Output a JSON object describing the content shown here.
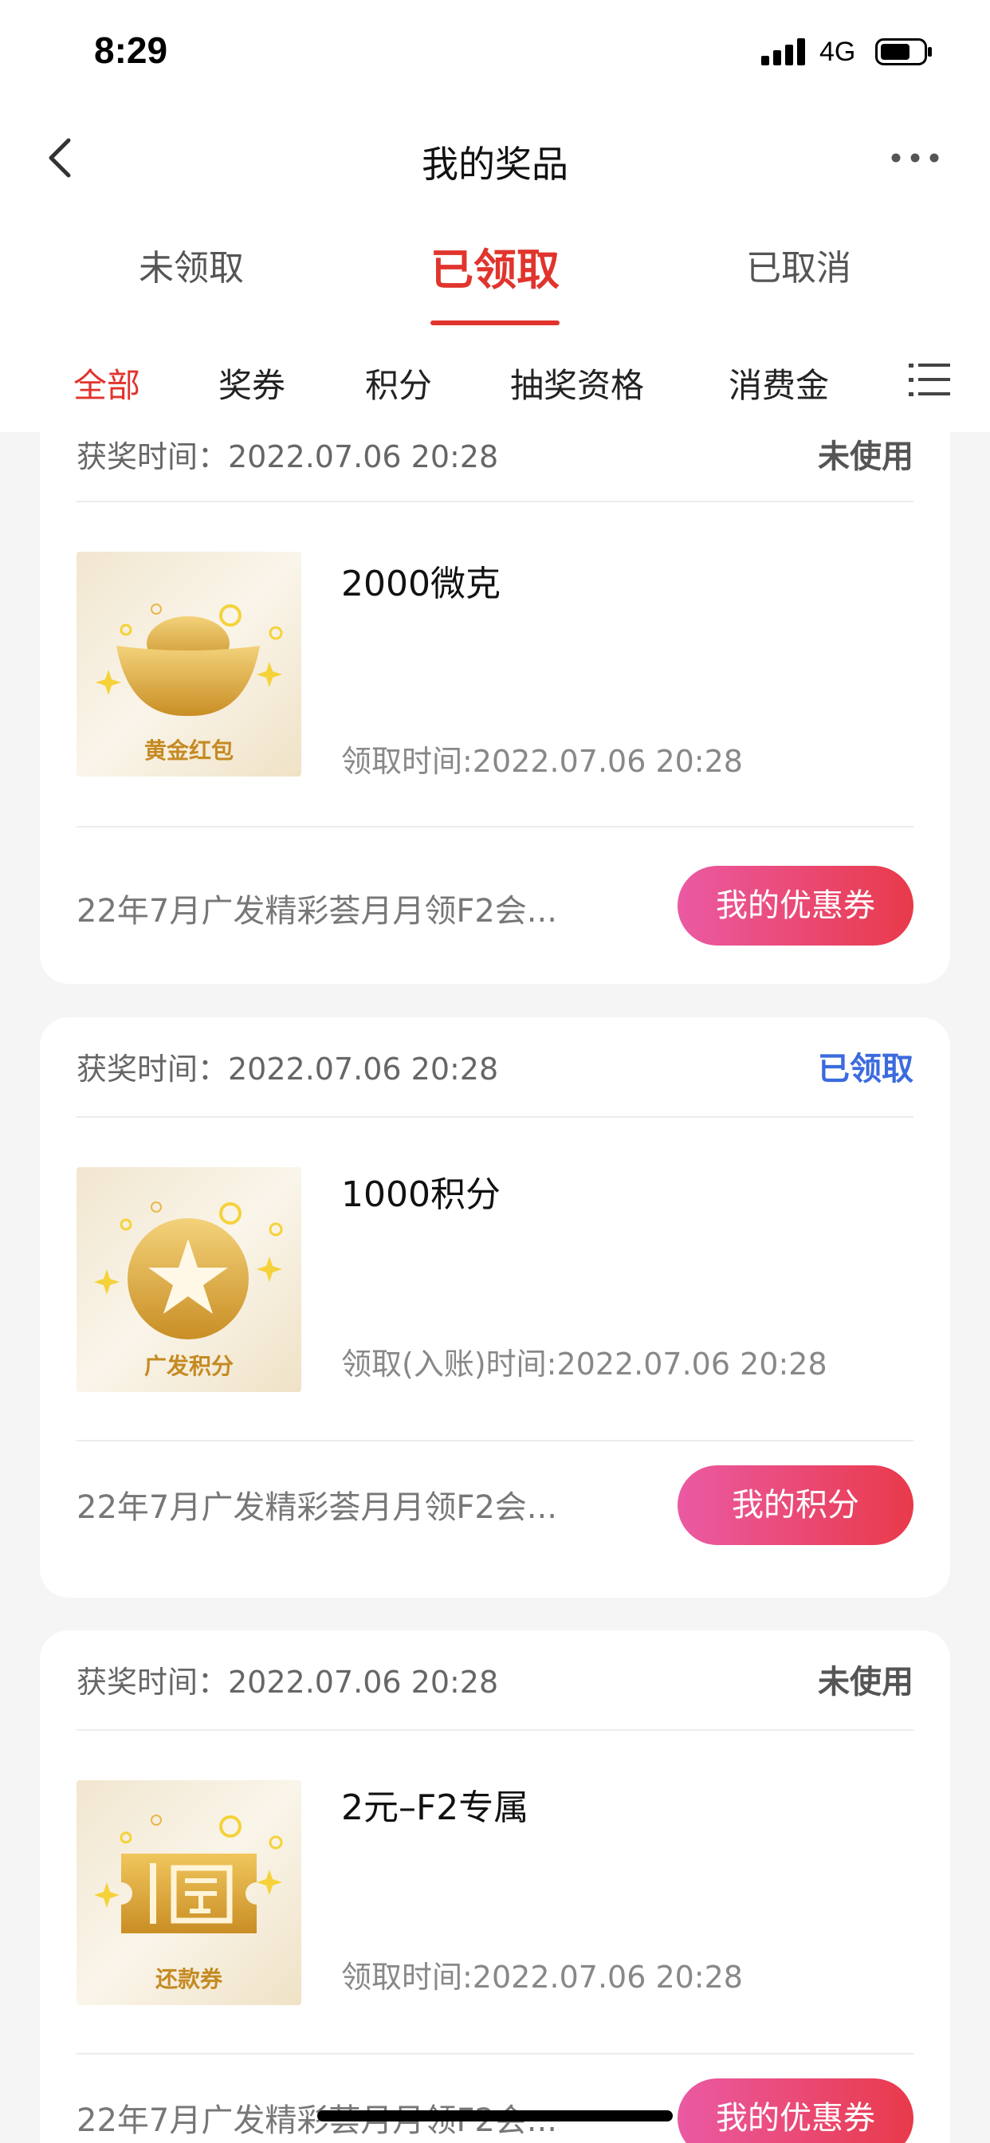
{
  "status_bar": {
    "time": "8:29",
    "network": "4G"
  },
  "nav": {
    "title": "我的奖品"
  },
  "tabs": [
    {
      "label": "未领取",
      "active": false
    },
    {
      "label": "已领取",
      "active": true
    },
    {
      "label": "已取消",
      "active": false
    }
  ],
  "categories": [
    {
      "label": "全部",
      "active": true
    },
    {
      "label": "奖券",
      "active": false
    },
    {
      "label": "积分",
      "active": false
    },
    {
      "label": "抽奖资格",
      "active": false
    },
    {
      "label": "消费金",
      "active": false
    }
  ],
  "colors": {
    "accent": "#e0342d",
    "claimed_blue": "#3b6bdd",
    "button_start": "#ea5aa3",
    "button_end": "#e93a4a"
  },
  "prizes": [
    {
      "award_time": "获奖时间：2022.07.06 20:28",
      "status": "未使用",
      "name": "2000微克",
      "thumb_label": "黄金红包",
      "thumb_icon": "gold-ingot-icon",
      "claim_time": "领取时间:2022.07.06 20:28",
      "activity": "22年7月广发精彩荟月月领F2会...",
      "button": "我的优惠券"
    },
    {
      "award_time": "获奖时间：2022.07.06 20:28",
      "status": "已领取",
      "name": "1000积分",
      "thumb_label": "广发积分",
      "thumb_icon": "star-coin-icon",
      "claim_time": "领取(入账)时间:2022.07.06 20:28",
      "activity": "22年7月广发精彩荟月月领F2会...",
      "button": "我的积分"
    },
    {
      "award_time": "获奖时间：2022.07.06 20:28",
      "status": "未使用",
      "name": "2元–F2专属",
      "thumb_label": "还款券",
      "thumb_icon": "repayment-ticket-icon",
      "claim_time": "领取时间:2022.07.06 20:28",
      "activity": "22年7月广发精彩荟月月领F2会...",
      "button": "我的优惠券"
    }
  ]
}
